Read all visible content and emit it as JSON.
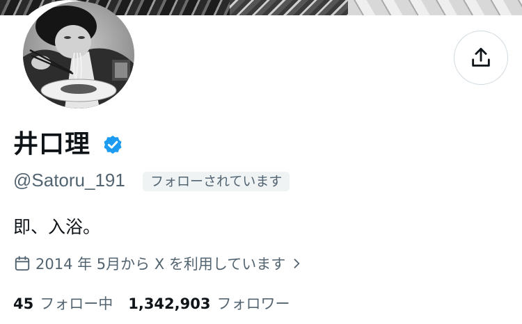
{
  "profile": {
    "display_name": "井口理",
    "handle": "@Satoru_191",
    "follows_you_label": "フォローされています",
    "bio": "即、入浴。",
    "join_date": "2014 年 5月から X を利用しています",
    "verified": true
  },
  "stats": {
    "following_count": "45",
    "following_label": "フォロー中",
    "followers_count": "1,342,903",
    "followers_label": "フォロワー"
  },
  "icons": {
    "share": "share-upload-icon",
    "verified": "verified-badge-icon",
    "calendar": "calendar-icon",
    "chevron": "chevron-right-icon"
  },
  "colors": {
    "text_primary": "#0f1419",
    "text_secondary": "#536471",
    "verified_blue": "#1d9bf0",
    "badge_bg": "#eff3f4",
    "border": "#cfd9de"
  }
}
